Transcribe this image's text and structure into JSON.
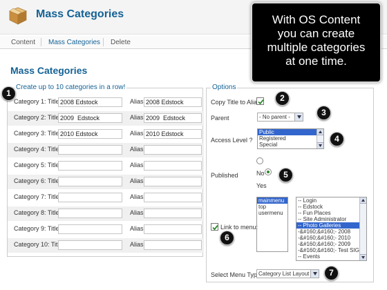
{
  "header": {
    "title": "Mass Categories",
    "icon": "box-icon"
  },
  "callout": {
    "lines": [
      "With OS Content",
      "you can create",
      "multiple categories",
      "at one time."
    ]
  },
  "submenu": {
    "items": [
      {
        "label": "Content",
        "active": false
      },
      {
        "label": "Mass Categories",
        "active": true
      },
      {
        "label": "Delete",
        "active": false
      }
    ]
  },
  "page": {
    "title": "Mass Categories"
  },
  "left_panel": {
    "legend": "Create up to 10 categories in a row!",
    "alias_label": "Alias:",
    "rows": [
      {
        "label": "Category 1: Title:",
        "title": "2008 Edstock",
        "alias": "2008 Edstock"
      },
      {
        "label": "Category 2: Title:",
        "title": "2009  Edstock",
        "alias": "2009  Edstock"
      },
      {
        "label": "Category 3: Title:",
        "title": "2010 Edstock",
        "alias": "2010 Edstock"
      },
      {
        "label": "Category 4: Title:",
        "title": "",
        "alias": ""
      },
      {
        "label": "Category 5: Title:",
        "title": "",
        "alias": ""
      },
      {
        "label": "Category 6: Title:",
        "title": "",
        "alias": ""
      },
      {
        "label": "Category 7: Title:",
        "title": "",
        "alias": ""
      },
      {
        "label": "Category 8: Title:",
        "title": "",
        "alias": ""
      },
      {
        "label": "Category 9: Title:",
        "title": "",
        "alias": ""
      },
      {
        "label": "Category 10: Title:",
        "title": "",
        "alias": ""
      }
    ]
  },
  "options": {
    "legend": "Options",
    "copy_title_label": "Copy Title to Alias",
    "copy_title_checked": true,
    "parent_label": "Parent",
    "parent_value": "- No parent -",
    "access_label": "Access Level ?",
    "access_options": [
      "Public",
      "Registered",
      "Special"
    ],
    "access_selected": "Public",
    "published_label": "Published",
    "published_no": "No",
    "published_yes": "Yes",
    "link_label": "Link to menu:",
    "link_checked": true,
    "menus": [
      "mainmenu",
      "top",
      "usermenu"
    ],
    "menus_selected": "mainmenu",
    "menu_items": [
      "-- Login",
      "-- Edstock",
      "-- Fun Places",
      "-- Site Administrator",
      "-- Photo Galleries",
      "-&#160;&#160;- 2008",
      "-&#160;&#160;- 2010",
      "-&#160;&#160;- 2009",
      "-&#160;&#160;- Test SIG",
      "-- Events"
    ],
    "menu_items_selected": "-- Photo Galleries",
    "menu_type_label": "Select Menu Type:",
    "menu_type_value": "Category List Layout"
  },
  "badges": [
    "1",
    "2",
    "3",
    "4",
    "5",
    "6",
    "7"
  ],
  "colors": {
    "heading": "#146295",
    "callout_bg": "#000000",
    "badge_bg": "#111111",
    "list_selected": "#3366cc"
  }
}
